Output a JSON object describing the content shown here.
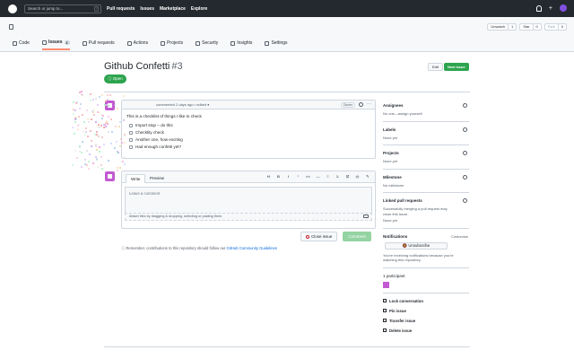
{
  "topbar": {
    "search_placeholder": "Search or jump to...",
    "search_shortcut": "/",
    "nav": [
      "Pull requests",
      "Issues",
      "Marketplace",
      "Explore"
    ],
    "plus_label": "+"
  },
  "repo": {
    "unwatch": "Unwatch",
    "unwatch_count": "1",
    "star": "Star",
    "star_count": "0",
    "fork": "Fork",
    "fork_count": "0"
  },
  "tabs": [
    {
      "label": "Code"
    },
    {
      "label": "Issues",
      "count": "1"
    },
    {
      "label": "Pull requests"
    },
    {
      "label": "Actions"
    },
    {
      "label": "Projects"
    },
    {
      "label": "Security"
    },
    {
      "label": "Insights"
    },
    {
      "label": "Settings"
    }
  ],
  "issue": {
    "title": "Github Confetti",
    "number": "#3",
    "edit": "Edit",
    "new_issue": "New issue",
    "status": "Open"
  },
  "comment": {
    "meta": "commented 2 days ago • edited",
    "meta_caret": "▾",
    "owner": "Owner",
    "more": "···",
    "body": "This is a checklist of things I like to check",
    "tasks": [
      {
        "text": "Import stop – do this",
        "checked": false
      },
      {
        "text": "Checklity check",
        "checked": false
      },
      {
        "text": "Another one, how exciting",
        "checked": false
      },
      {
        "text": "Had enough confetti yet?",
        "checked": false
      }
    ]
  },
  "editor": {
    "write": "Write",
    "preview": "Preview",
    "tools": [
      "H",
      "B",
      "I",
      "“",
      "<>",
      "―",
      "≡",
      "1.",
      "☑",
      "@",
      "↰"
    ],
    "placeholder": "Leave a comment",
    "attach": "Attach files by dragging & dropping, selecting or pasting them.",
    "close_issue": "Close issue",
    "comment": "Comment"
  },
  "guidelines": {
    "prefix": "ⓘ Remember, contributions to this repository should follow our",
    "link": "GitHub Community Guidelines"
  },
  "sidebar": {
    "assignees": {
      "title": "Assignees",
      "value": "No one—assign yourself"
    },
    "labels": {
      "title": "Labels",
      "value": "None yet"
    },
    "projects": {
      "title": "Projects",
      "value": "None yet"
    },
    "milestone": {
      "title": "Milestone",
      "value": "No milestone"
    },
    "linked": {
      "title": "Linked pull requests",
      "value": "Successfully merging a pull request may close this issue.",
      "value2": "None yet"
    },
    "notifications": {
      "title": "Notifications",
      "customize": "Customize",
      "button": "🔕 Unsubscribe",
      "note": "You're receiving notifications because you're watching this repository."
    },
    "participants": {
      "title": "1 participant"
    },
    "actions": [
      "Lock conversation",
      "Pin issue",
      "Transfer issue",
      "Delete issue"
    ]
  }
}
